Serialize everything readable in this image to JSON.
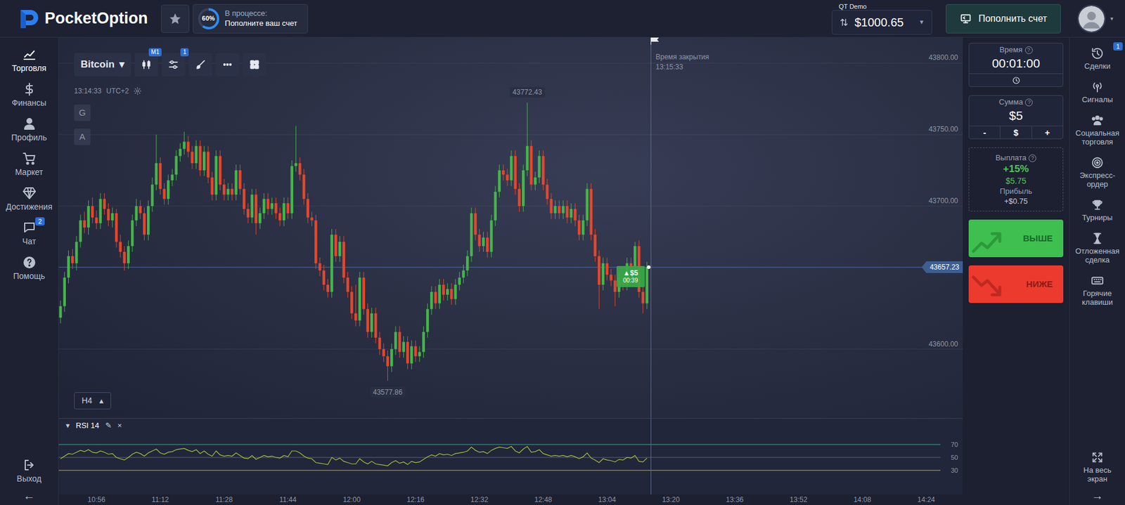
{
  "topbar": {
    "logo": [
      "Pocket",
      "Option"
    ],
    "progress": {
      "percent": "60%",
      "level": 0.6,
      "status": "В процессе:",
      "task": "Пополните ваш счет"
    },
    "account": {
      "type": "QT Demo",
      "balance": "$1000.65",
      "caret": "▼"
    },
    "deposit": "Пополнить счет",
    "avatar_caret": "▾"
  },
  "left_nav": {
    "items": [
      {
        "label": "Торговля",
        "selected": true
      },
      {
        "label": "Финансы",
        "selected": false
      },
      {
        "label": "Профиль",
        "selected": false
      },
      {
        "label": "Маркет",
        "selected": false
      },
      {
        "label": "Достижения",
        "selected": false
      },
      {
        "label": "Чат",
        "selected": false,
        "badge": "2"
      },
      {
        "label": "Помощь",
        "selected": false
      }
    ],
    "bottom": [
      {
        "label": "Выход"
      }
    ],
    "collapse": "←"
  },
  "chart": {
    "asset": "Bitcoin",
    "asset_caret": "▾",
    "tools": [
      {
        "badge": "M1"
      },
      {
        "badge": "1"
      },
      {},
      {},
      {}
    ],
    "clock": "13:14:33",
    "timezone": "UTC+2",
    "side_buttons": [
      "G",
      "A"
    ],
    "timeframe": "H4",
    "timeframe_caret": "▴",
    "price_labels": [
      "43800.00",
      "43750.00",
      "43700.00",
      "43600.00"
    ],
    "high_label": "43772.43",
    "low_label": "43577.86",
    "current_price": "43657.23",
    "close_time": {
      "title": "Время закрытия",
      "time": "13:15:33"
    },
    "trade": {
      "direction": "▲",
      "amount": "$5",
      "remaining": "00:39"
    },
    "time_labels": [
      "10:56",
      "11:12",
      "11:28",
      "11:44",
      "12:00",
      "12:16",
      "12:32",
      "12:48",
      "13:04",
      "13:20",
      "13:36",
      "13:52",
      "14:08",
      "14:24"
    ],
    "candles": [
      [
        43622,
        43634,
        43618,
        43630
      ],
      [
        43630,
        43654,
        43626,
        43650
      ],
      [
        43650,
        43669,
        43646,
        43665
      ],
      [
        43665,
        43670,
        43656,
        43660
      ],
      [
        43660,
        43679,
        43655,
        43675
      ],
      [
        43675,
        43694,
        43671,
        43690
      ],
      [
        43690,
        43696,
        43681,
        43685
      ],
      [
        43685,
        43704,
        43680,
        43700
      ],
      [
        43700,
        43706,
        43688,
        43692
      ],
      [
        43692,
        43697,
        43684,
        43688
      ],
      [
        43688,
        43709,
        43684,
        43705
      ],
      [
        43705,
        43709,
        43694,
        43698
      ],
      [
        43698,
        43702,
        43686,
        43690
      ],
      [
        43690,
        43699,
        43685,
        43695
      ],
      [
        43695,
        43698,
        43671,
        43675
      ],
      [
        43675,
        43680,
        43664,
        43668
      ],
      [
        43668,
        43672,
        43655,
        43660
      ],
      [
        43660,
        43676,
        43656,
        43672
      ],
      [
        43672,
        43694,
        43668,
        43690
      ],
      [
        43690,
        43705,
        43686,
        43700
      ],
      [
        43700,
        43704,
        43691,
        43695
      ],
      [
        43695,
        43699,
        43676,
        43680
      ],
      [
        43680,
        43704,
        43676,
        43700
      ],
      [
        43700,
        43720,
        43696,
        43715
      ],
      [
        43715,
        43750,
        43711,
        43730
      ],
      [
        43730,
        43734,
        43708,
        43712
      ],
      [
        43712,
        43716,
        43701,
        43705
      ],
      [
        43705,
        43722,
        43701,
        43718
      ],
      [
        43718,
        43726,
        43714,
        43722
      ],
      [
        43722,
        43739,
        43718,
        43735
      ],
      [
        43735,
        43744,
        43731,
        43740
      ],
      [
        43740,
        43752,
        43736,
        43745
      ],
      [
        43745,
        43749,
        43734,
        43738
      ],
      [
        43738,
        43742,
        43726,
        43730
      ],
      [
        43730,
        43746,
        43726,
        43742
      ],
      [
        43742,
        43746,
        43721,
        43725
      ],
      [
        43725,
        43742,
        43721,
        43738
      ],
      [
        43738,
        43742,
        43716,
        43720
      ],
      [
        43720,
        43724,
        43704,
        43708
      ],
      [
        43708,
        43739,
        43704,
        43735
      ],
      [
        43735,
        43739,
        43711,
        43715
      ],
      [
        43715,
        43719,
        43704,
        43708
      ],
      [
        43708,
        43716,
        43704,
        43712
      ],
      [
        43712,
        43716,
        43704,
        43708
      ],
      [
        43708,
        43729,
        43704,
        43725
      ],
      [
        43725,
        43729,
        43708,
        43712
      ],
      [
        43712,
        43716,
        43694,
        43698
      ],
      [
        43698,
        43702,
        43688,
        43692
      ],
      [
        43692,
        43712,
        43688,
        43708
      ],
      [
        43708,
        43712,
        43680,
        43688
      ],
      [
        43688,
        43699,
        43684,
        43695
      ],
      [
        43695,
        43709,
        43691,
        43705
      ],
      [
        43705,
        43709,
        43694,
        43698
      ],
      [
        43698,
        43706,
        43694,
        43702
      ],
      [
        43702,
        43706,
        43691,
        43695
      ],
      [
        43695,
        43699,
        43686,
        43690
      ],
      [
        43690,
        43706,
        43686,
        43702
      ],
      [
        43702,
        43706,
        43691,
        43695
      ],
      [
        43695,
        43732,
        43691,
        43728
      ],
      [
        43728,
        43756,
        43724,
        43730
      ],
      [
        43730,
        43734,
        43718,
        43722
      ],
      [
        43722,
        43726,
        43701,
        43705
      ],
      [
        43705,
        43709,
        43688,
        43692
      ],
      [
        43692,
        43696,
        43686,
        43690
      ],
      [
        43690,
        43694,
        43656,
        43660
      ],
      [
        43660,
        43664,
        43651,
        43655
      ],
      [
        43655,
        43659,
        43641,
        43645
      ],
      [
        43645,
        43649,
        43636,
        43640
      ],
      [
        43640,
        43684,
        43636,
        43680
      ],
      [
        43680,
        43684,
        43661,
        43665
      ],
      [
        43665,
        43679,
        43661,
        43675
      ],
      [
        43675,
        43679,
        43646,
        43650
      ],
      [
        43650,
        43654,
        43636,
        43640
      ],
      [
        43640,
        43644,
        43621,
        43625
      ],
      [
        43625,
        43645,
        43616,
        43620
      ],
      [
        43620,
        43654,
        43616,
        43650
      ],
      [
        43650,
        43654,
        43624,
        43628
      ],
      [
        43628,
        43632,
        43608,
        43612
      ],
      [
        43612,
        43629,
        43608,
        43625
      ],
      [
        43625,
        43629,
        43604,
        43608
      ],
      [
        43608,
        43612,
        43596,
        43600
      ],
      [
        43600,
        43604,
        43591,
        43595
      ],
      [
        43595,
        43599,
        43577.86,
        43588
      ],
      [
        43588,
        43604,
        43584,
        43600
      ],
      [
        43600,
        43616,
        43596,
        43612
      ],
      [
        43612,
        43616,
        43594,
        43598
      ],
      [
        43598,
        43609,
        43594,
        43605
      ],
      [
        43605,
        43609,
        43586,
        43590
      ],
      [
        43590,
        43606,
        43586,
        43602
      ],
      [
        43602,
        43606,
        43591,
        43595
      ],
      [
        43595,
        43602,
        43591,
        43598
      ],
      [
        43598,
        43616,
        43594,
        43612
      ],
      [
        43612,
        43632,
        43608,
        43628
      ],
      [
        43628,
        43644,
        43624,
        43640
      ],
      [
        43640,
        43644,
        43628,
        43632
      ],
      [
        43632,
        43649,
        43628,
        43645
      ],
      [
        43645,
        43649,
        43634,
        43638
      ],
      [
        43638,
        43646,
        43634,
        43642
      ],
      [
        43642,
        43646,
        43631,
        43635
      ],
      [
        43635,
        43649,
        43631,
        43645
      ],
      [
        43645,
        43654,
        43641,
        43650
      ],
      [
        43650,
        43659,
        43646,
        43655
      ],
      [
        43655,
        43669,
        43651,
        43665
      ],
      [
        43665,
        43699,
        43661,
        43695
      ],
      [
        43695,
        43699,
        43676,
        43680
      ],
      [
        43680,
        43684,
        43668,
        43672
      ],
      [
        43672,
        43682,
        43668,
        43678
      ],
      [
        43678,
        43682,
        43664,
        43668
      ],
      [
        43668,
        43694,
        43664,
        43690
      ],
      [
        43690,
        43714,
        43686,
        43710
      ],
      [
        43710,
        43729,
        43706,
        43725
      ],
      [
        43725,
        43729,
        43718,
        43722
      ],
      [
        43722,
        43726,
        43714,
        43718
      ],
      [
        43718,
        43739,
        43714,
        43735
      ],
      [
        43735,
        43739,
        43708,
        43712
      ],
      [
        43712,
        43716,
        43696,
        43700
      ],
      [
        43700,
        43729,
        43696,
        43725
      ],
      [
        43725,
        43772.43,
        43721,
        43742
      ],
      [
        43742,
        43746,
        43711,
        43715
      ],
      [
        43715,
        43724,
        43711,
        43720
      ],
      [
        43720,
        43739,
        43716,
        43735
      ],
      [
        43735,
        43739,
        43711,
        43715
      ],
      [
        43715,
        43719,
        43701,
        43705
      ],
      [
        43705,
        43709,
        43691,
        43695
      ],
      [
        43695,
        43704,
        43691,
        43700
      ],
      [
        43700,
        43704,
        43691,
        43695
      ],
      [
        43695,
        43704,
        43691,
        43700
      ],
      [
        43700,
        43704,
        43688,
        43692
      ],
      [
        43692,
        43702,
        43688,
        43698
      ],
      [
        43698,
        43702,
        43686,
        43690
      ],
      [
        43690,
        43694,
        43676,
        43680
      ],
      [
        43680,
        43694,
        43676,
        43690
      ],
      [
        43690,
        43716,
        43686,
        43712
      ],
      [
        43712,
        43716,
        43676,
        43680
      ],
      [
        43680,
        43684,
        43661,
        43665
      ],
      [
        43665,
        43669,
        43628,
        43645
      ],
      [
        43645,
        43664,
        43641,
        43660
      ],
      [
        43660,
        43664,
        43648,
        43652
      ],
      [
        43652,
        43656,
        43644,
        43648
      ],
      [
        43648,
        43652,
        43630,
        43640
      ],
      [
        43640,
        43654,
        43636,
        43650
      ],
      [
        43650,
        43654,
        43641,
        43645
      ],
      [
        43645,
        43664,
        43641,
        43660
      ],
      [
        43660,
        43664,
        43654,
        43658
      ],
      [
        43658,
        43675,
        43654,
        43672
      ],
      [
        43672,
        43676,
        43636,
        43640
      ],
      [
        43640,
        43644,
        43625,
        43632
      ],
      [
        43632,
        43661,
        43628,
        43657.23
      ]
    ]
  },
  "rsi": {
    "collapse": "▾",
    "title": "RSI 14",
    "edit": "✎",
    "close": "×",
    "levels": [
      {
        "label": "70",
        "color": "#3fa98b"
      },
      {
        "label": "50",
        "color": "#5d6478"
      },
      {
        "label": "30",
        "color": "#b7b445"
      }
    ],
    "values": [
      48,
      52,
      56,
      55,
      58,
      61,
      59,
      62,
      58,
      57,
      60,
      58,
      55,
      56,
      50,
      48,
      46,
      50,
      55,
      58,
      56,
      52,
      57,
      60,
      63,
      57,
      55,
      58,
      59,
      62,
      63,
      64,
      61,
      59,
      62,
      56,
      60,
      55,
      52,
      60,
      54,
      52,
      53,
      52,
      57,
      53,
      49,
      48,
      53,
      47,
      50,
      53,
      51,
      52,
      50,
      49,
      53,
      51,
      60,
      60,
      57,
      52,
      49,
      48,
      42,
      41,
      40,
      39,
      50,
      46,
      49,
      44,
      42,
      40,
      40,
      48,
      43,
      40,
      44,
      40,
      39,
      38,
      37,
      42,
      45,
      41,
      43,
      39,
      44,
      42,
      43,
      47,
      51,
      54,
      52,
      56,
      54,
      55,
      53,
      56,
      57,
      58,
      60,
      66,
      61,
      58,
      59,
      56,
      61,
      64,
      66,
      65,
      64,
      67,
      60,
      57,
      63,
      67,
      58,
      59,
      62,
      56,
      54,
      52,
      53,
      52,
      53,
      51,
      53,
      51,
      48,
      51,
      57,
      49,
      46,
      42,
      48,
      46,
      45,
      43,
      47,
      46,
      50,
      49,
      53,
      44,
      43,
      49
    ]
  },
  "order_panel": {
    "time": {
      "label": "Время",
      "help": "?",
      "value": "00:01:00"
    },
    "amount": {
      "label": "Сумма",
      "help": "?",
      "value": "$5",
      "buttons": [
        "-",
        "$",
        "+"
      ]
    },
    "payout": {
      "label": "Выплата",
      "help": "?",
      "percent": "+15%",
      "total": "$5.75",
      "profit_label": "Прибыль",
      "profit": "+$0.75"
    },
    "buttons": [
      {
        "label": "ВЫШЕ",
        "kind": "up"
      },
      {
        "label": "НИЖЕ",
        "kind": "down"
      }
    ]
  },
  "right_nav": {
    "items": [
      {
        "label": "Сделки",
        "badge": "1"
      },
      {
        "label": "Сигналы"
      },
      {
        "label": "Социальная торговля"
      },
      {
        "label": "Экспресс-ордер"
      },
      {
        "label": "Турниры"
      },
      {
        "label": "Отложенная сделка"
      },
      {
        "label": "Горячие клавиши"
      }
    ],
    "bottom": [
      {
        "label": "На весь экран"
      }
    ],
    "expand": "→"
  }
}
